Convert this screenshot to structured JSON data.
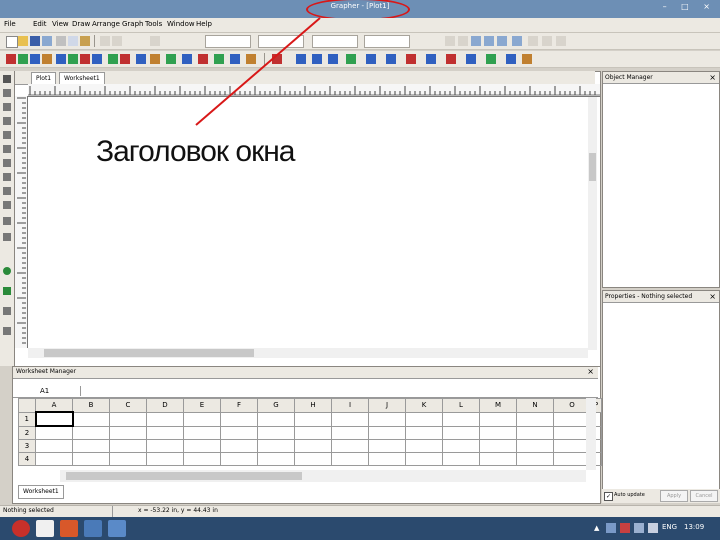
{
  "window": {
    "title": "Grapher - [Plot1]",
    "controls": "– □ ×"
  },
  "menu": [
    "File",
    "Edit",
    "View",
    "Draw",
    "Arrange",
    "Graph",
    "Tools",
    "Window",
    "Help"
  ],
  "tabs": [
    "Plot1",
    "Worksheet1"
  ],
  "annotation": "Заголовок окна",
  "worksheet_manager": {
    "title": "Worksheet Manager",
    "cell_ref": "A1",
    "columns": [
      "A",
      "B",
      "C",
      "D",
      "E",
      "F",
      "G",
      "H",
      "I",
      "J",
      "K",
      "L",
      "M",
      "N",
      "O",
      "P"
    ],
    "rows": [
      "1",
      "2",
      "3",
      "4"
    ],
    "sheet_tab": "Worksheet1"
  },
  "object_manager": {
    "title": "Object Manager"
  },
  "property_manager": {
    "title": "Properties - Nothing selected",
    "auto_update_label": "Auto update",
    "apply_label": "Apply",
    "cancel_label": "Cancel"
  },
  "status": {
    "left": "Nothing selected",
    "coords": "x = -53.22 in, y = 44.43 in"
  },
  "taskbar": {
    "lang": "ENG",
    "time": "13:09"
  },
  "colors": {
    "highlight": "#d81818",
    "titlebar": "#6d8fb5",
    "taskbar": "#2b4a6e"
  }
}
